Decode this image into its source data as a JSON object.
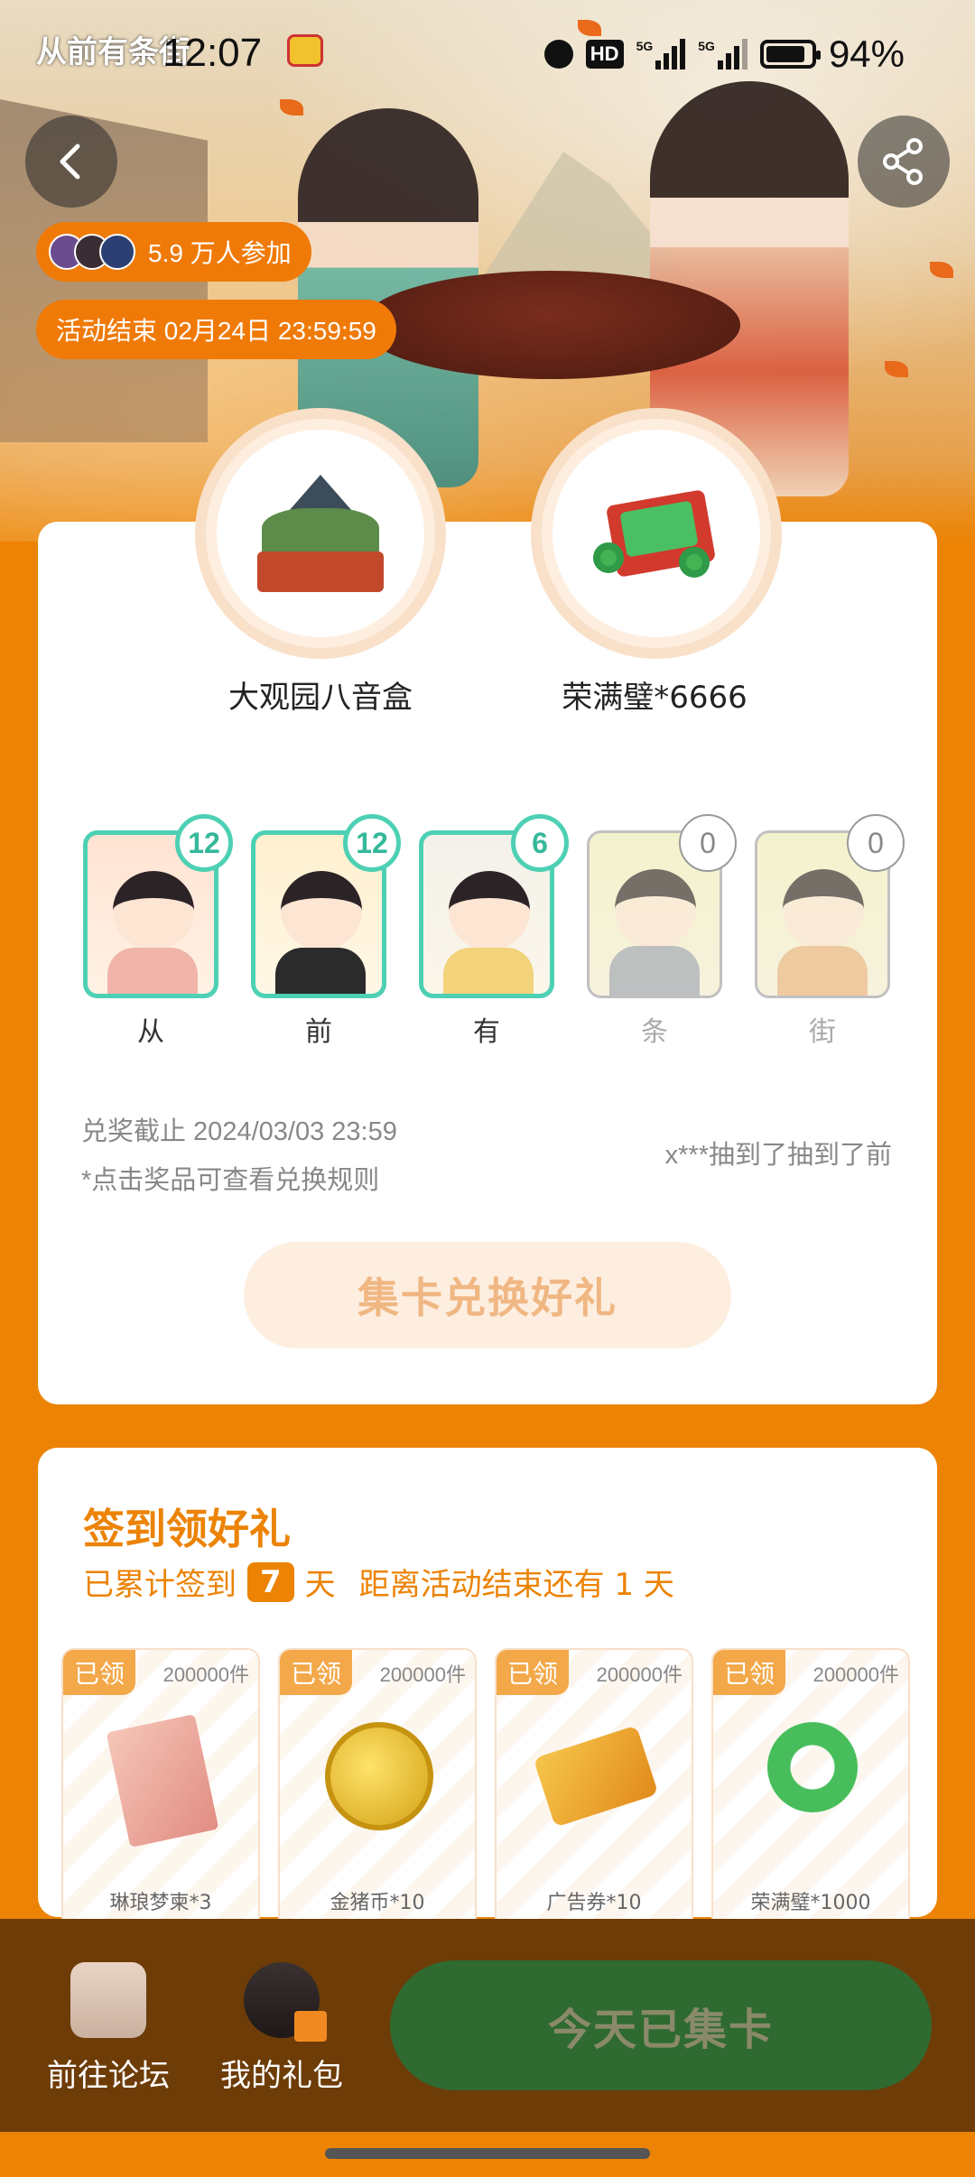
{
  "status_bar": {
    "app_logo": "从前有条街",
    "time": "12:07",
    "battery": "94%",
    "hd_label": "HD",
    "net_1": "5G",
    "net_2": "5G"
  },
  "header": {
    "participants": "5.9 万人参加",
    "end_time": "活动结束 02月24日 23:59:59"
  },
  "prizes": [
    {
      "name": "大观园八音盒"
    },
    {
      "name": "荣满璧*6666"
    }
  ],
  "cards": [
    {
      "label": "从",
      "count": "12",
      "collected": true
    },
    {
      "label": "前",
      "count": "12",
      "collected": true
    },
    {
      "label": "有",
      "count": "6",
      "collected": true
    },
    {
      "label": "条",
      "count": "0",
      "collected": false
    },
    {
      "label": "街",
      "count": "0",
      "collected": false
    }
  ],
  "redeem": {
    "deadline": "兑奖截止 2024/03/03 23:59",
    "rule_tip": "*点击奖品可查看兑换规则",
    "ticker": "x***抽到了抽到了前",
    "button": "集卡兑换好礼"
  },
  "signin": {
    "title": "签到领好礼",
    "sub_prefix": "已累计签到",
    "days": "7",
    "sub_suffix": "天",
    "remaining": "距离活动结束还有 1 天",
    "gifts": [
      {
        "tag": "已领",
        "stock": "200000件",
        "name": "琳琅梦柬*3",
        "icon": "scroll-icon"
      },
      {
        "tag": "已领",
        "stock": "200000件",
        "name": "金猪币*10",
        "icon": "coin-icon"
      },
      {
        "tag": "已领",
        "stock": "200000件",
        "name": "广告券*10",
        "icon": "ticket-icon"
      },
      {
        "tag": "已领",
        "stock": "200000件",
        "name": "荣满璧*1000",
        "icon": "jade-icon"
      }
    ]
  },
  "bottom_bar": {
    "forum": "前往论坛",
    "my_gifts": "我的礼包",
    "today_button": "今天已集卡"
  },
  "colors": {
    "accent": "#ec8304",
    "card_border": "#4dd0b4",
    "bottom_bar": "#6e3c07",
    "today_button": "#2f6a31"
  }
}
